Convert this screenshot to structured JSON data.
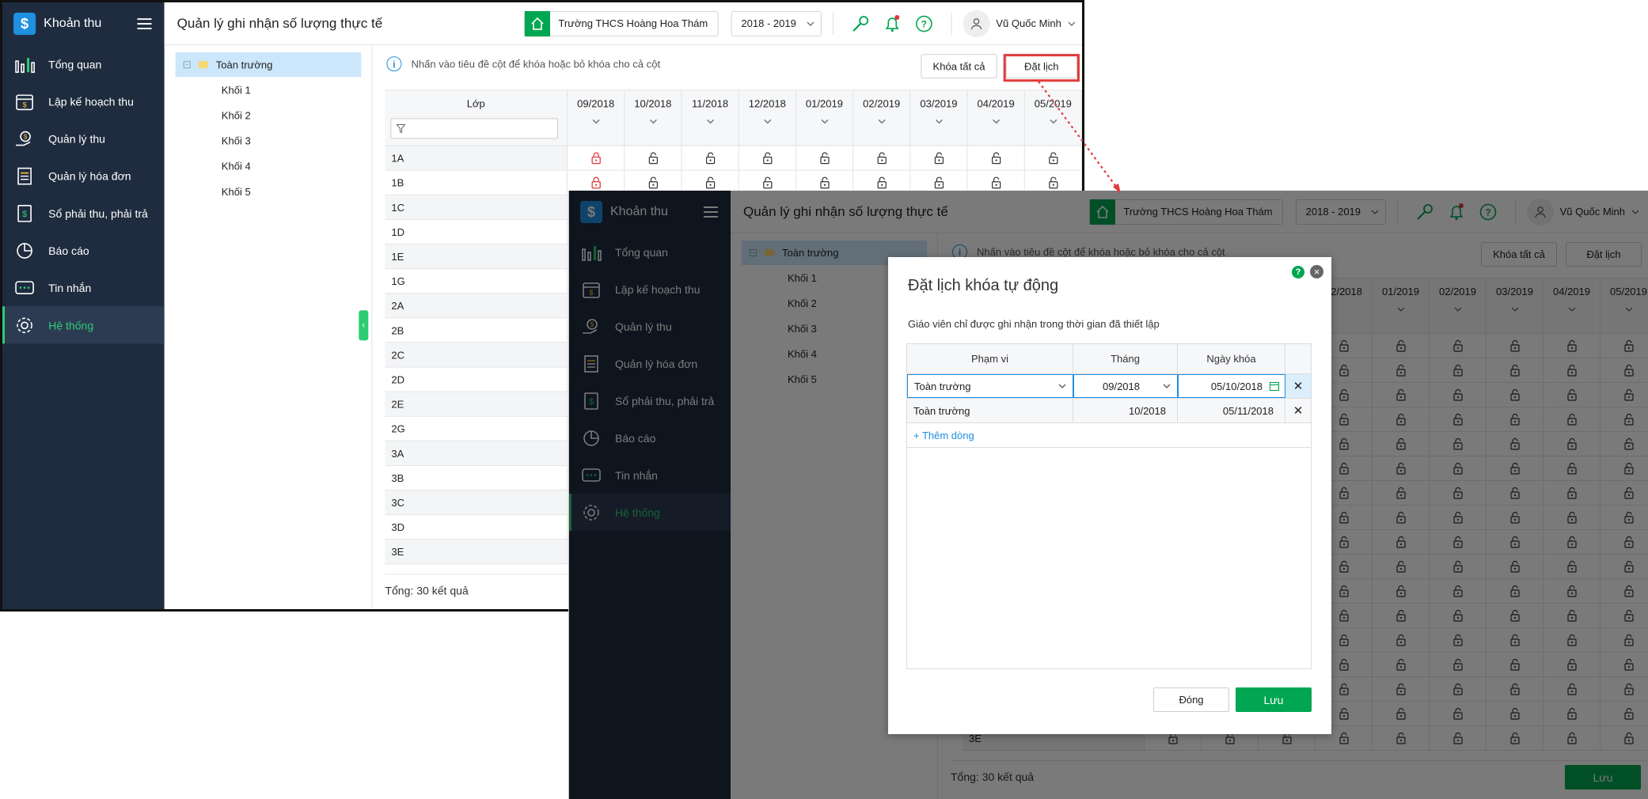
{
  "app": {
    "name": "Khoản thu",
    "page_title": "Quản lý ghi nhận số lượng thực tế"
  },
  "header": {
    "school": "Trường THCS Hoàng Hoa Thám",
    "year": "2018 - 2019",
    "user": "Vũ Quốc Minh"
  },
  "nav": [
    {
      "label": "Tổng quan",
      "icon": "chart-icon"
    },
    {
      "label": "Lập kế hoạch thu",
      "icon": "calendar-icon"
    },
    {
      "label": "Quản lý thu",
      "icon": "money-hand-icon"
    },
    {
      "label": "Quản lý hóa đơn",
      "icon": "invoice-icon"
    },
    {
      "label": "Sổ phải thu, phải trả",
      "icon": "ledger-icon"
    },
    {
      "label": "Báo cáo",
      "icon": "pie-chart-icon"
    },
    {
      "label": "Tin nhắn",
      "icon": "message-icon"
    },
    {
      "label": "Hệ thống",
      "icon": "gear-icon"
    }
  ],
  "tree": {
    "root": "Toàn trường",
    "children": [
      "Khối 1",
      "Khối 2",
      "Khối 3",
      "Khối 4",
      "Khối 5"
    ]
  },
  "toolbar": {
    "info": "Nhấn vào tiêu đề cột để khóa hoặc bỏ khóa cho cả cột",
    "lock_all": "Khóa tất cả",
    "schedule": "Đặt lịch"
  },
  "grid": {
    "class_header": "Lớp",
    "months": [
      "09/2018",
      "10/2018",
      "11/2018",
      "12/2018",
      "01/2019",
      "02/2019",
      "03/2019",
      "04/2019",
      "05/2019"
    ],
    "classes": [
      "1A",
      "1B",
      "1C",
      "1D",
      "1E",
      "1G",
      "2A",
      "2B",
      "2C",
      "2D",
      "2E",
      "2G",
      "3A",
      "3B",
      "3C",
      "3D",
      "3E"
    ],
    "locked_rows": [
      "1A",
      "1B"
    ],
    "total": "Tổng: 30 kết quả"
  },
  "modal": {
    "title": "Đặt lịch khóa tự động",
    "description": "Giáo viên chỉ được ghi nhận trong thời gian đã thiết lập",
    "columns": [
      "Phạm vi",
      "Tháng",
      "Ngày khóa"
    ],
    "rows": [
      {
        "scope": "Toàn trường",
        "month": "09/2018",
        "lock_date": "05/10/2018"
      },
      {
        "scope": "Toàn trường",
        "month": "10/2018",
        "lock_date": "05/11/2018"
      }
    ],
    "add_row": "+ Thêm dòng",
    "close": "Đóng",
    "save": "Lưu"
  },
  "colors": {
    "sidebar": "#1f2c3f",
    "accent_green": "#00a651",
    "active_green": "#2ecc71",
    "primary_blue": "#1f8fe0",
    "lock_red": "#e03a3a",
    "highlight_red": "#e03a3a"
  }
}
